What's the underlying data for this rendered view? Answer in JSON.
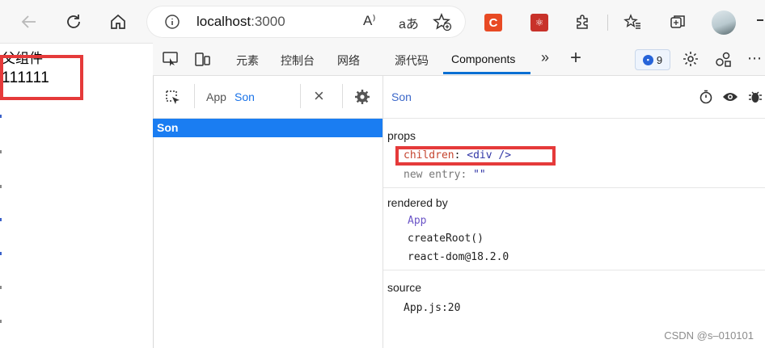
{
  "browser": {
    "address_host": "localhost",
    "address_port": ":3000",
    "read_aloud_label": "A⁾",
    "translate_label": "aあ",
    "ext_c_label": "C"
  },
  "page": {
    "title": "父组件",
    "content": "111111"
  },
  "devtools": {
    "tabs": [
      "元素",
      "控制台",
      "网络",
      "源代码",
      "Components"
    ],
    "active_tab": "Components",
    "more_label": "»",
    "add_label": "+",
    "issues_count": "9",
    "tree": {
      "breadcrumb_app": "App",
      "breadcrumb_son": "Son",
      "close_label": "×",
      "selected_item": "Son"
    },
    "details": {
      "component_name": "Son",
      "props_title": "props",
      "props": [
        {
          "key": "children",
          "sep": ": ",
          "value": "<div />"
        },
        {
          "key": "new entry",
          "sep": ": ",
          "value": "\"\""
        }
      ],
      "rendered_by_title": "rendered by",
      "rendered_by": [
        "App",
        "createRoot()",
        "react-dom@18.2.0"
      ],
      "source_title": "source",
      "source": "App.js:20"
    }
  },
  "watermark": "CSDN @s–010101",
  "colors": {
    "accent": "#1a7df2",
    "highlight_box": "#e53a3a",
    "prop_key": "#c5442e",
    "prop_value": "#3036a6"
  }
}
